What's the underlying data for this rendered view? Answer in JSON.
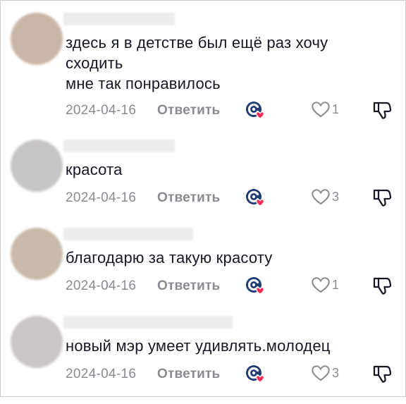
{
  "comments": [
    {
      "text": "здесь я в детстве был ещё раз хочу\nсходить\nмне так понравилось",
      "date": "2024-04-16",
      "reply_label": "Ответить",
      "likes": "1",
      "avatar_color": "#c9b5a5"
    },
    {
      "text": "красота",
      "date": "2024-04-16",
      "reply_label": "Ответить",
      "likes": "3",
      "avatar_color": "#c7c4c6"
    },
    {
      "text": "благодарю за такую красоту",
      "date": "2024-04-16",
      "reply_label": "Ответить",
      "likes": "1",
      "avatar_color": "#c8baa9"
    },
    {
      "text": "новый мэр умеет удивлять.молодец",
      "date": "2024-04-16",
      "reply_label": "Ответить",
      "likes": "3",
      "avatar_color": "#cac5c9"
    }
  ],
  "icons": {
    "sticker": "sticker-react-icon",
    "like": "heart-outline-icon",
    "dislike": "thumbs-down-icon"
  },
  "colors": {
    "text": "#161823",
    "muted": "#8a8b91",
    "sticker_blue": "#1f3c73",
    "sticker_heart": "#fe2c55"
  }
}
